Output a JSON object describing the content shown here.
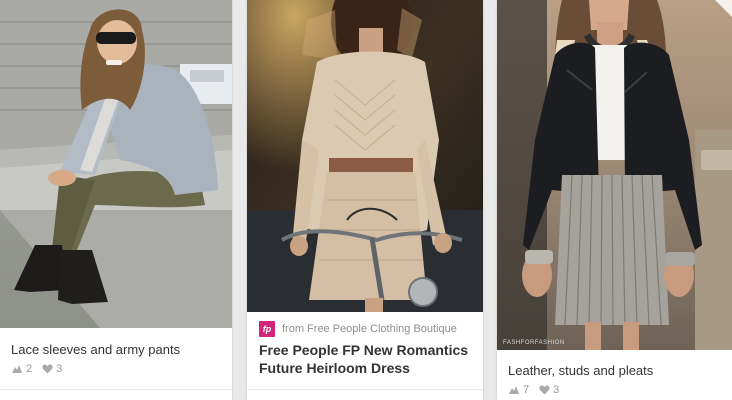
{
  "pins": [
    {
      "description": "Lace sleeves and army pants",
      "repins": "2",
      "likes": "3",
      "icons": {
        "repin": "repin-icon",
        "like": "heart-icon"
      }
    },
    {
      "source_prefix": "from Free People Clothing Boutique",
      "source_badge": "fp",
      "title": "Free People FP New Romantics Future Heirloom Dress"
    },
    {
      "watermark": "FASHFORFASHION",
      "description": "Leather, studs and pleats",
      "repins": "7",
      "likes": "3",
      "icons": {
        "repin": "repin-icon",
        "like": "heart-icon"
      }
    }
  ],
  "colors": {
    "background": "#e9e9e9",
    "card": "#ffffff",
    "text": "#333333",
    "meta": "#999999",
    "source_badge": "#d4257d"
  }
}
